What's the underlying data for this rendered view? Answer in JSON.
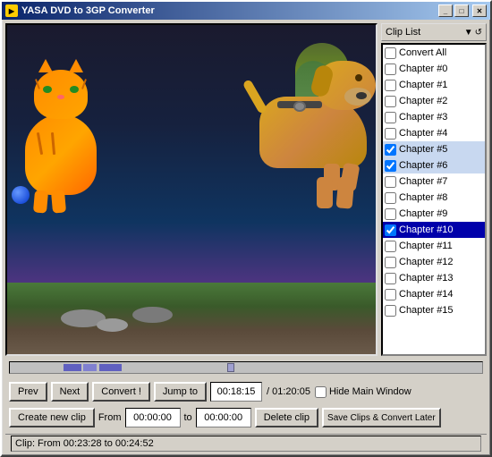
{
  "window": {
    "title": "YASA DVD to 3GP Converter",
    "icon": "▶"
  },
  "titlebar": {
    "minimize_label": "_",
    "maximize_label": "□",
    "close_label": "✕"
  },
  "clip_list": {
    "header_label": "Clip List",
    "items": [
      {
        "label": "Convert All",
        "checked": false,
        "selected": false
      },
      {
        "label": "Chapter #0",
        "checked": false,
        "selected": false
      },
      {
        "label": "Chapter #1",
        "checked": false,
        "selected": false
      },
      {
        "label": "Chapter #2",
        "checked": false,
        "selected": false
      },
      {
        "label": "Chapter #3",
        "checked": false,
        "selected": false
      },
      {
        "label": "Chapter #4",
        "checked": false,
        "selected": false
      },
      {
        "label": "Chapter #5",
        "checked": true,
        "selected": false
      },
      {
        "label": "Chapter #6",
        "checked": true,
        "selected": false
      },
      {
        "label": "Chapter #7",
        "checked": false,
        "selected": false
      },
      {
        "label": "Chapter #8",
        "checked": false,
        "selected": false
      },
      {
        "label": "Chapter #9",
        "checked": false,
        "selected": false
      },
      {
        "label": "Chapter #10",
        "checked": true,
        "selected": true
      },
      {
        "label": "Chapter #11",
        "checked": false,
        "selected": false
      },
      {
        "label": "Chapter #12",
        "checked": false,
        "selected": false
      },
      {
        "label": "Chapter #13",
        "checked": false,
        "selected": false
      },
      {
        "label": "Chapter #14",
        "checked": false,
        "selected": false
      },
      {
        "label": "Chapter #15",
        "checked": false,
        "selected": false
      }
    ]
  },
  "controls": {
    "prev_label": "Prev",
    "next_label": "Next",
    "convert_label": "Convert !",
    "jump_to_label": "Jump to",
    "current_time": "00:18:15",
    "total_time": "/ 01:20:05",
    "hide_window_label": "Hide Main Window",
    "create_clip_label": "Create new clip",
    "from_label": "From",
    "from_time": "00:00:00",
    "to_label": "to",
    "to_time": "00:00:00",
    "delete_clip_label": "Delete clip",
    "save_clips_label": "Save Clips & Convert Later"
  },
  "status": {
    "text": "Clip: From 00:23:28 to 00:24:52"
  }
}
